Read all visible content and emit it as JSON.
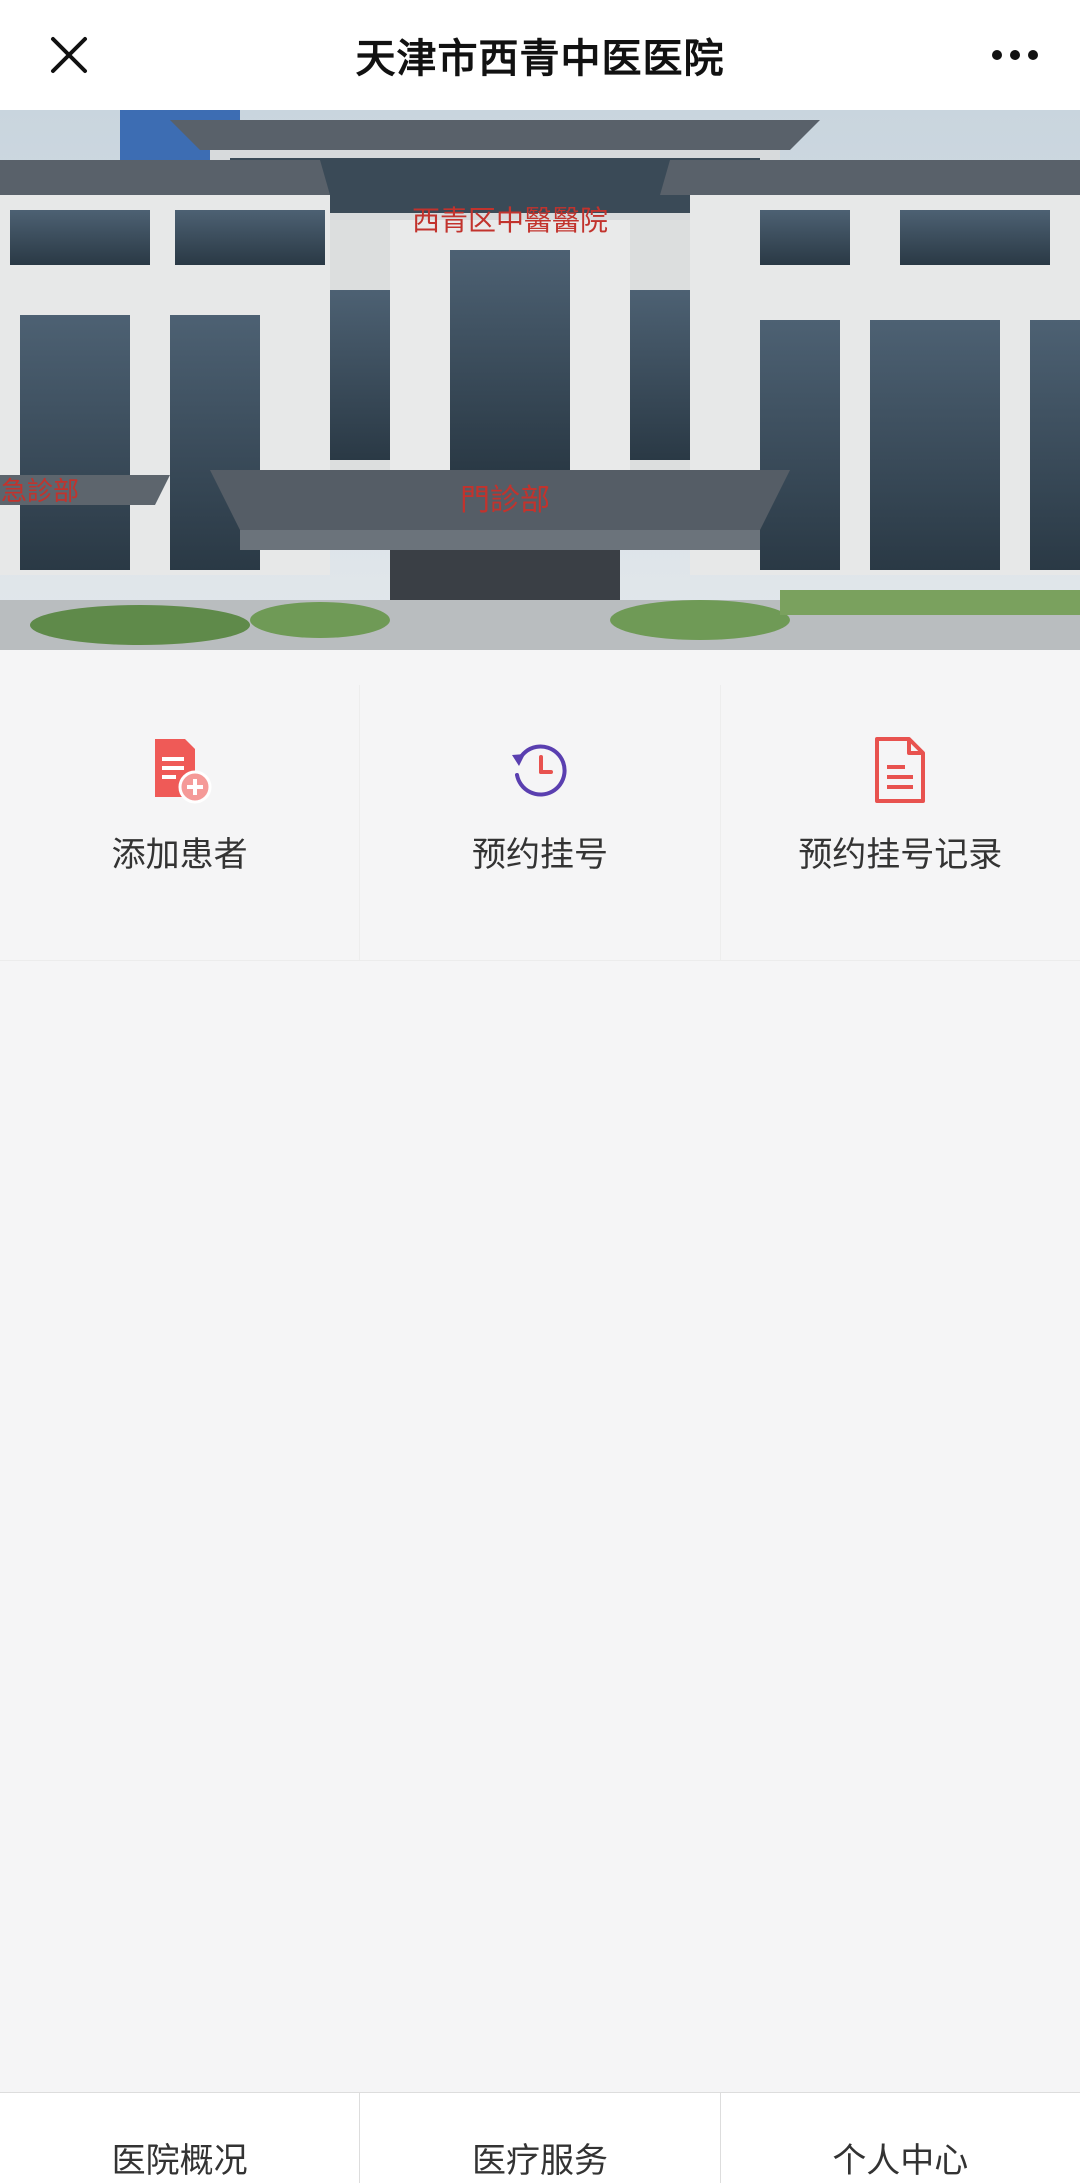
{
  "header": {
    "title": "天津市西青中医医院",
    "close_icon": "close-icon",
    "more_icon": "more-dots-icon"
  },
  "banner": {
    "sign_main": "西青区中醫醫院",
    "sign_entrance": "門診部",
    "sign_left": "急診部"
  },
  "menu": {
    "items": [
      {
        "label": "添加患者",
        "icon": "add-patient-icon",
        "color": "#e8524f"
      },
      {
        "label": "预约挂号",
        "icon": "clock-refresh-icon",
        "color": "#5a3fb0"
      },
      {
        "label": "预约挂号记录",
        "icon": "document-record-icon",
        "color": "#e8524f"
      }
    ]
  },
  "tabbar": {
    "tabs": [
      {
        "label": "医院概况"
      },
      {
        "label": "医疗服务"
      },
      {
        "label": "个人中心"
      }
    ]
  }
}
